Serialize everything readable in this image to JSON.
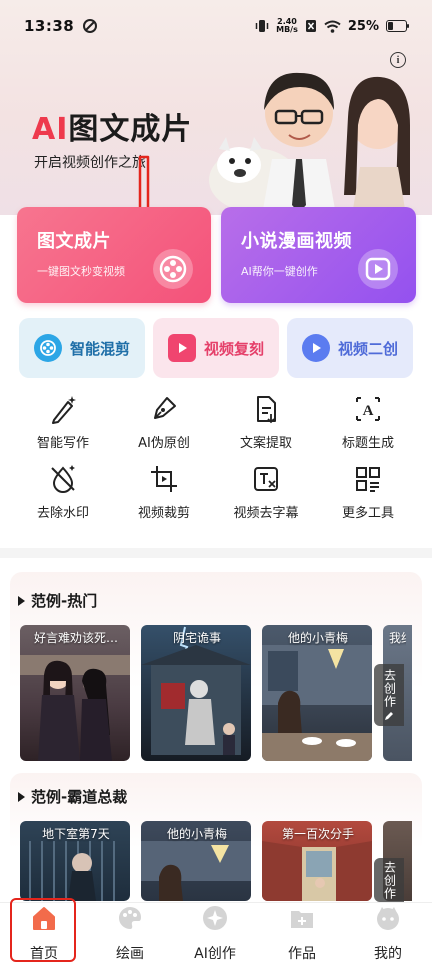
{
  "status": {
    "time": "13:38",
    "net_speed_top": "2.40",
    "net_speed_bottom": "MB/s",
    "battery": "25%"
  },
  "hero": {
    "title_ai": "AI",
    "title_rest": "图文成片",
    "subtitle": "开启视频创作之旅"
  },
  "cards": [
    {
      "title": "图文成片",
      "subtitle": "一键图文秒变视频"
    },
    {
      "title": "小说漫画视频",
      "subtitle": "AI帮你一键创作"
    }
  ],
  "pills": [
    {
      "label": "智能混剪",
      "icon": "film-reel-icon"
    },
    {
      "label": "视频复刻",
      "icon": "video-play-icon"
    },
    {
      "label": "视频二创",
      "icon": "play-circle-icon"
    }
  ],
  "tools": [
    {
      "label": "智能写作",
      "icon": "magic-pen-icon"
    },
    {
      "label": "AI伪原创",
      "icon": "fountain-pen-icon"
    },
    {
      "label": "文案提取",
      "icon": "document-export-icon"
    },
    {
      "label": "标题生成",
      "icon": "text-frame-icon"
    },
    {
      "label": "去除水印",
      "icon": "no-watermark-icon"
    },
    {
      "label": "视频裁剪",
      "icon": "crop-icon"
    },
    {
      "label": "视频去字幕",
      "icon": "remove-subtitle-icon"
    },
    {
      "label": "更多工具",
      "icon": "grid-icon"
    }
  ],
  "sections": [
    {
      "title": "范例-热门",
      "items": [
        "好言难劝该死…",
        "阴宅诡事",
        "他的小青梅",
        "我结"
      ],
      "more_label": "去创作"
    },
    {
      "title": "范例-霸道总裁",
      "items": [
        "地下室第7天",
        "他的小青梅",
        "第一百次分手"
      ],
      "more_label": "去创作"
    }
  ],
  "tabbar": [
    {
      "label": "首页",
      "icon": "home-icon",
      "active": true
    },
    {
      "label": "绘画",
      "icon": "palette-icon"
    },
    {
      "label": "AI创作",
      "icon": "sparkle-icon"
    },
    {
      "label": "作品",
      "icon": "folder-add-icon"
    },
    {
      "label": "我的",
      "icon": "profile-face-icon"
    }
  ],
  "colors": {
    "accent_red": "#e4251c",
    "ai_red": "#ee3a4d",
    "pink_card": "#f4527a",
    "purple_card": "#9451ef"
  }
}
